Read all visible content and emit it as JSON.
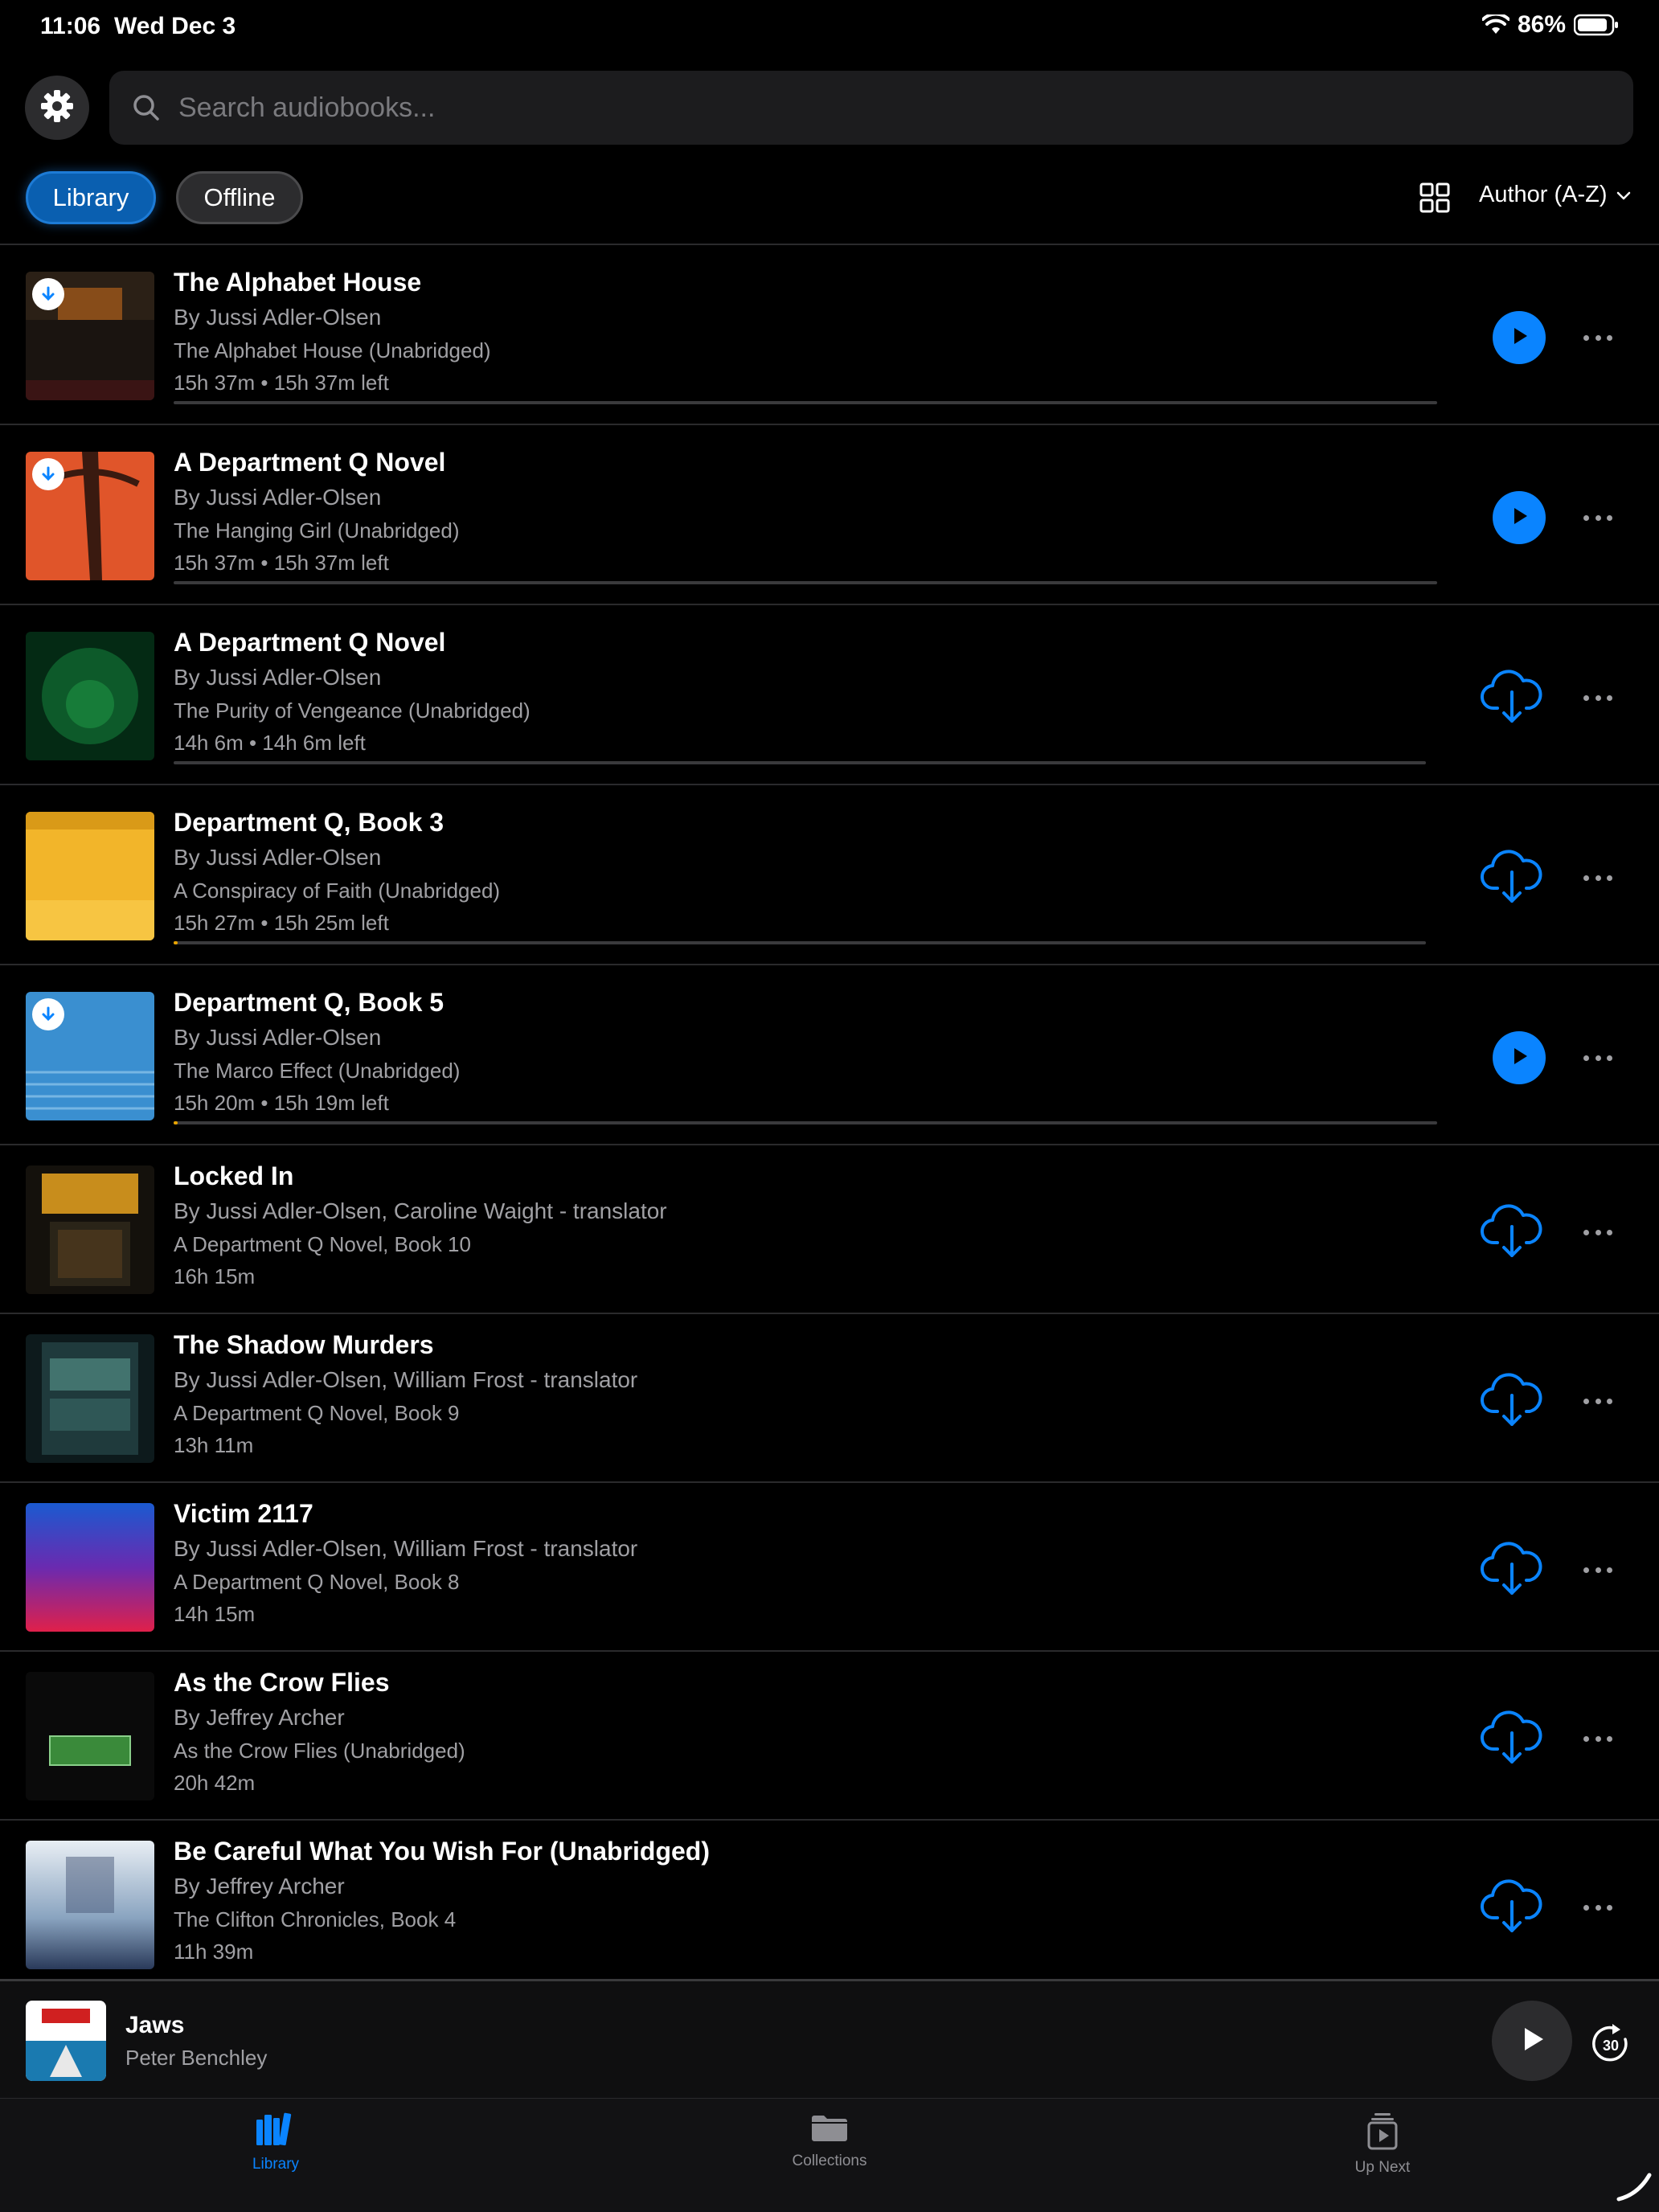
{
  "status_bar": {
    "time": "11:06",
    "date": "Wed Dec 3",
    "battery": "86%"
  },
  "search": {
    "placeholder": "Search audiobooks..."
  },
  "filters": {
    "library": "Library",
    "offline": "Offline",
    "sort": "Author (A-Z)"
  },
  "books": [
    {
      "title": "The Alphabet House",
      "author": "By Jussi Adler-Olsen",
      "subtitle": "The Alphabet House (Unabridged)",
      "duration": "15h 37m • 15h 37m left",
      "progress": 0,
      "downloaded": true,
      "action": "play"
    },
    {
      "title": "A Department Q Novel",
      "author": "By Jussi Adler-Olsen",
      "subtitle": "The Hanging Girl (Unabridged)",
      "duration": "15h 37m • 15h 37m left",
      "progress": 0,
      "downloaded": true,
      "action": "play"
    },
    {
      "title": "A Department Q Novel",
      "author": "By Jussi Adler-Olsen",
      "subtitle": "The Purity of Vengeance (Unabridged)",
      "duration": "14h 6m • 14h 6m left",
      "progress": 0,
      "downloaded": false,
      "action": "download"
    },
    {
      "title": "Department Q, Book 3",
      "author": "By Jussi Adler-Olsen",
      "subtitle": "A Conspiracy of Faith (Unabridged)",
      "duration": "15h 27m • 15h 25m left",
      "progress": 0.003,
      "downloaded": false,
      "action": "download"
    },
    {
      "title": "Department Q, Book 5",
      "author": "By Jussi Adler-Olsen",
      "subtitle": "The Marco Effect (Unabridged)",
      "duration": "15h 20m • 15h 19m left",
      "progress": 0.001,
      "downloaded": true,
      "action": "play"
    },
    {
      "title": "Locked In",
      "author": "By Jussi Adler-Olsen, Caroline Waight - translator",
      "subtitle": "A Department Q Novel, Book 10",
      "duration": "16h 15m",
      "downloaded": false,
      "action": "download"
    },
    {
      "title": "The Shadow Murders",
      "author": "By Jussi Adler-Olsen, William Frost - translator",
      "subtitle": "A Department Q Novel, Book 9",
      "duration": "13h 11m",
      "downloaded": false,
      "action": "download"
    },
    {
      "title": "Victim 2117",
      "author": "By Jussi Adler-Olsen, William Frost - translator",
      "subtitle": "A Department Q Novel, Book 8",
      "duration": "14h 15m",
      "downloaded": false,
      "action": "download"
    },
    {
      "title": "As the Crow Flies",
      "author": "By Jeffrey Archer",
      "subtitle": "As the Crow Flies (Unabridged)",
      "duration": "20h 42m",
      "downloaded": false,
      "action": "download"
    },
    {
      "title": "Be Careful What You Wish For (Unabridged)",
      "author": "By Jeffrey Archer",
      "subtitle": "The Clifton Chronicles, Book 4",
      "duration": "11h 39m",
      "downloaded": false,
      "action": "download"
    }
  ],
  "now_playing": {
    "title": "Jaws",
    "author": "Peter Benchley",
    "skip_seconds": "30"
  },
  "tabs": {
    "library": "Library",
    "collections": "Collections",
    "up_next": "Up Next"
  },
  "colors": {
    "accent": "#0a84ff",
    "progress": "#e8a300"
  }
}
